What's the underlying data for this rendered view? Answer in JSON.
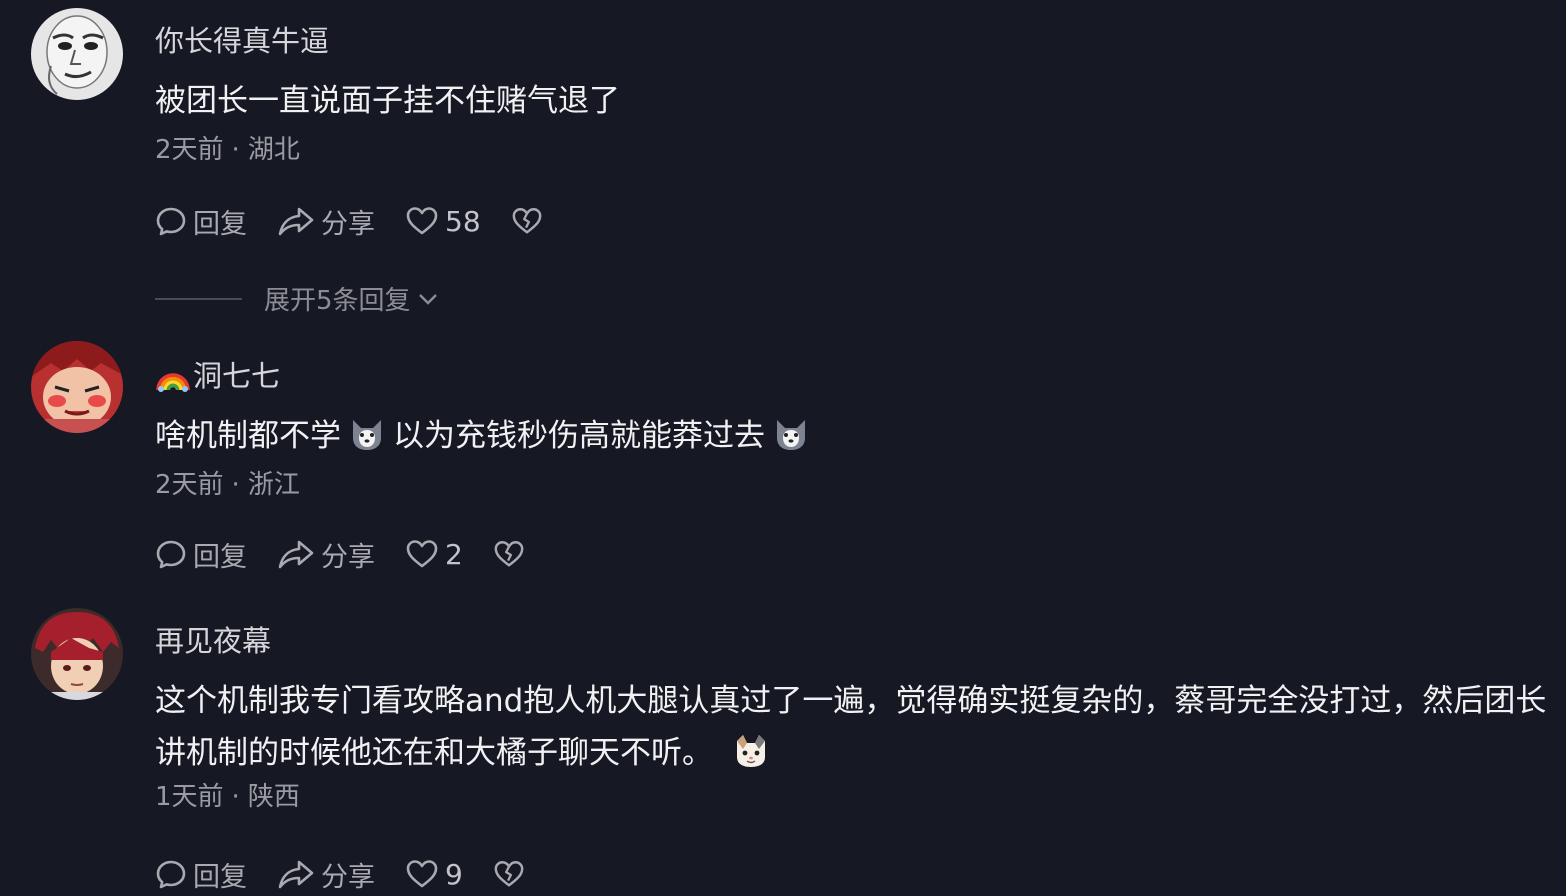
{
  "comments": [
    {
      "username": "你长得真牛逼",
      "avatar": "meme-face-avatar",
      "text": "被团长一直说面子挂不住赌气退了",
      "time": "2天前",
      "separator": "·",
      "location": "湖北",
      "reply_label": "回复",
      "share_label": "分享",
      "likes": "58",
      "expand_label": "展开5条回复"
    },
    {
      "username_prefix_icon": "rainbow-icon",
      "username": "洞七七",
      "avatar": "anime-red-hair-avatar",
      "text_part1": "啥机制都不学",
      "text_part2": "以为充钱秒伤高就能莽过去",
      "emoji": "husky-dog-emoji",
      "time": "2天前",
      "separator": "·",
      "location": "浙江",
      "reply_label": "回复",
      "share_label": "分享",
      "likes": "2"
    },
    {
      "username": "再见夜幕",
      "avatar": "anime-red-hair-boy-avatar",
      "text": "这个机制我专门看攻略and抱人机大腿认真过了一遍，觉得确实挺复杂的，蔡哥完全没打过，然后团长讲机制的时候他还在和大橘子聊天不听。",
      "emoji": "cat-emoji",
      "time": "1天前",
      "separator": "·",
      "location": "陕西",
      "reply_label": "回复",
      "share_label": "分享",
      "likes": "9"
    }
  ],
  "colors": {
    "background": "#161823",
    "text": "#f1f1f3",
    "meta": "#9a9ba2"
  }
}
